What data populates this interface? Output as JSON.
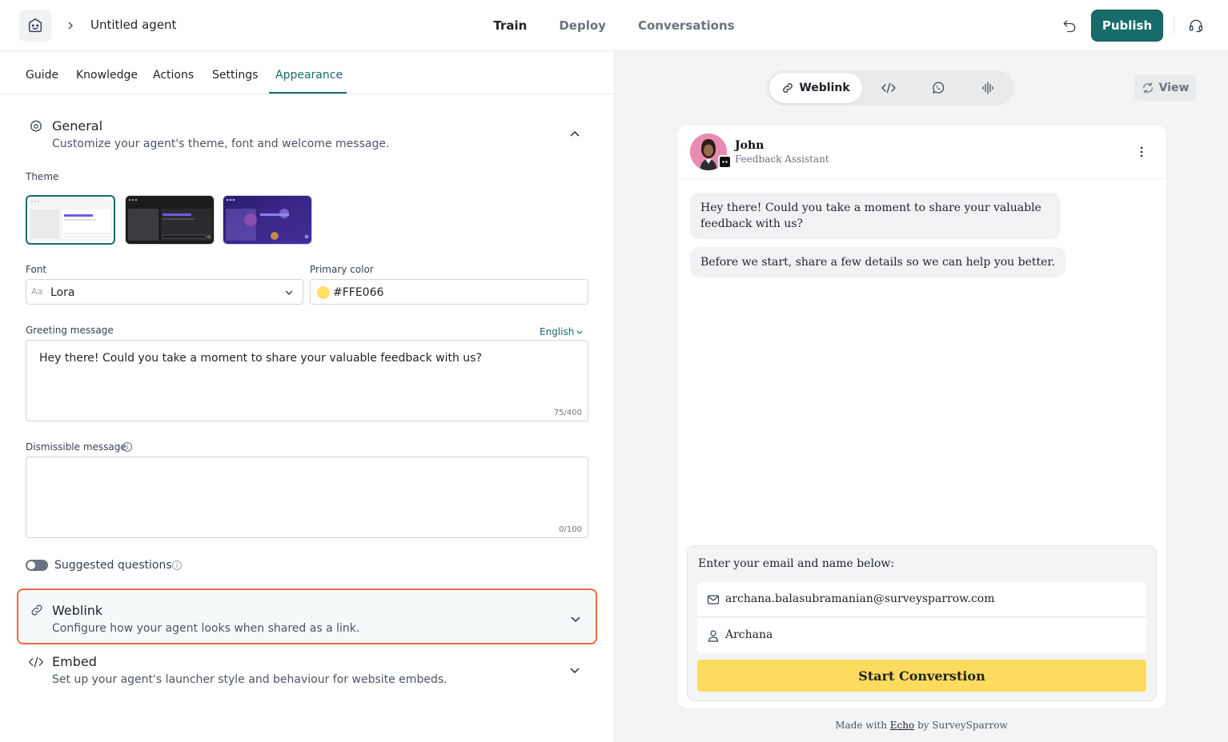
{
  "header": {
    "agent_name": "Untitled agent",
    "nav": [
      "Train",
      "Deploy",
      "Conversations"
    ],
    "active_nav": "Train",
    "publish_label": "Publish"
  },
  "subtabs": [
    "Guide",
    "Knowledge",
    "Actions",
    "Settings",
    "Appearance"
  ],
  "active_subtab": "Appearance",
  "general": {
    "title": "General",
    "description": "Customize your agent's theme, font and welcome message.",
    "theme_label": "Theme",
    "font_label": "Font",
    "font_value": "Lora",
    "font_prefix": "Aa",
    "primary_color_label": "Primary color",
    "primary_color_value": "#FFE066",
    "greeting_label": "Greeting message",
    "greeting_language": "English",
    "greeting_text": "Hey there! Could you take a moment to share your valuable feedback with us?",
    "greeting_count": "75/400",
    "dismissible_label": "Dismissible message",
    "dismissible_text": "",
    "dismissible_count": "0/100",
    "suggested_label": "Suggested questions"
  },
  "weblink_section": {
    "title": "Weblink",
    "description": "Configure how your agent looks when shared as a link."
  },
  "embed_section": {
    "title": "Embed",
    "description": "Set up your agent's launcher style and behaviour for website embeds."
  },
  "preview": {
    "channel_active": "Weblink",
    "view_label": "View",
    "bot_name": "John",
    "bot_role": "Feedback Assistant",
    "messages": [
      "Hey there! Could you take a moment to share your valuable feedback with us?",
      "Before we start, share a few details so we can help you better."
    ],
    "form_title": "Enter your email and name below:",
    "email_value": "archana.balasubramanian@surveysparrow.com",
    "name_value": "Archana",
    "start_label": "Start Converstion",
    "footer_made": "Made with",
    "footer_brand": "Echo",
    "footer_by": "by SurveySparrow"
  },
  "colors": {
    "accent": "#176b6b",
    "primary": "#ffe066",
    "highlight_border": "#ef6a42",
    "start_button": "#fcdb5e"
  }
}
